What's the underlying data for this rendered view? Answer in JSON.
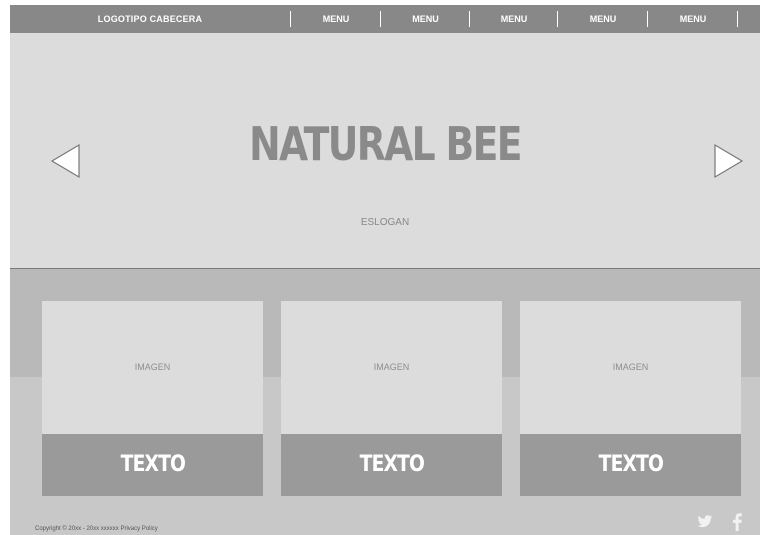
{
  "header": {
    "logo": "LOGOTIPO CABECERA",
    "menu": [
      "MENU",
      "MENU",
      "MENU",
      "MENU",
      "MENU"
    ]
  },
  "hero": {
    "title": "NATURAL BEE",
    "slogan": "ESLOGAN",
    "prev_icon": "triangle-left-outline",
    "next_icon": "triangle-right-outline"
  },
  "cards": [
    {
      "image_label": "IMAGEN",
      "text": "TEXTO"
    },
    {
      "image_label": "IMAGEN",
      "text": "TEXTO"
    },
    {
      "image_label": "IMAGEN",
      "text": "TEXTO"
    }
  ],
  "footer": {
    "copyright": "Copyright © 20xx - 20xx xxxxxx   Privacy Policy",
    "social": [
      "twitter-icon",
      "facebook-icon"
    ]
  },
  "colors": {
    "header_bg": "#888888",
    "hero_bg": "#dcdcdc",
    "card_text_bg": "#9a9a9a",
    "content_bg": "#c8c8c8"
  }
}
